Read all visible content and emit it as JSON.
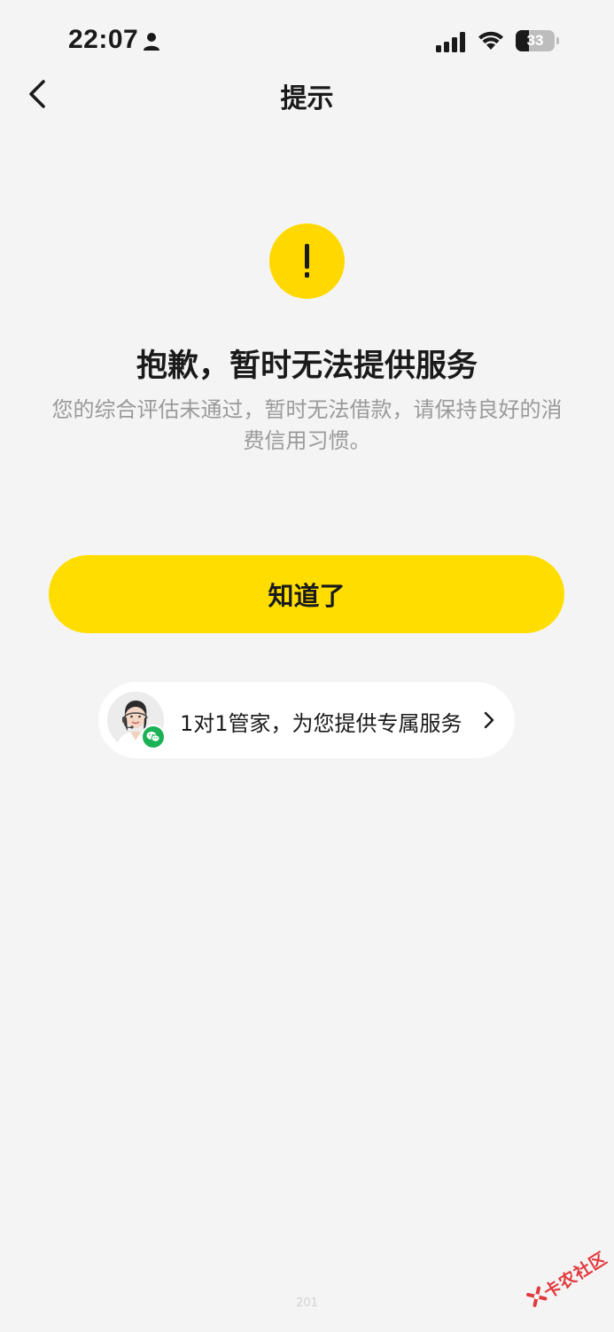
{
  "status_bar": {
    "time": "22:07",
    "battery_level": "33",
    "battery_fraction": 0.33
  },
  "nav": {
    "title": "提示"
  },
  "alert": {
    "icon": "exclamation-icon",
    "symbol": "!",
    "headline": "抱歉，暂时无法提供服务",
    "description": "您的综合评估未通过，暂时无法借款，请保持良好的消费信用习惯。"
  },
  "primary_button": {
    "label": "知道了"
  },
  "service": {
    "label": "1对1管家，为您提供专属服务"
  },
  "footer": {
    "code": "201"
  },
  "watermark": {
    "text": "卡农社区"
  },
  "colors": {
    "accent": "#ffdd00",
    "background": "#f4f4f4",
    "wechat_green": "#1bb157",
    "watermark_red": "#e2393c"
  }
}
